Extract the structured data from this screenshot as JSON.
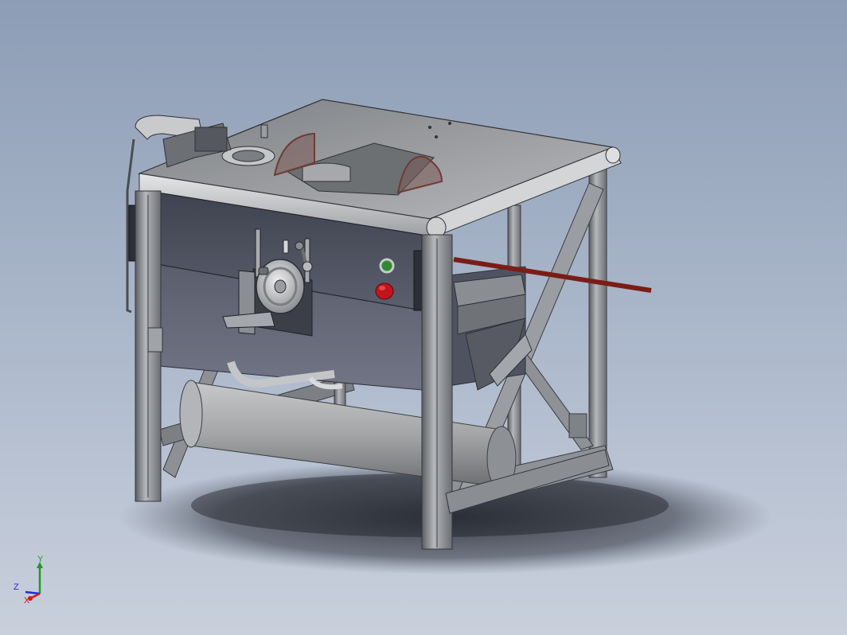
{
  "view": {
    "background_top": "#8d9db5",
    "background_bottom": "#c9d0dc"
  },
  "model": {
    "name": "table-saw-assembly",
    "colors": {
      "frame": "#8f949b",
      "panel": "#4b4f5c",
      "top": "#8c8f93",
      "guard": "#6e3b35",
      "rod": "#7a1d17",
      "button_green": "#2f8a2f",
      "button_red": "#c2141c"
    }
  },
  "triad": {
    "x_label": "X",
    "y_label": "Y",
    "z_label": "Z",
    "x_color": "#d11a1a",
    "y_color": "#1f9a1f",
    "z_color": "#1a2fd1"
  }
}
